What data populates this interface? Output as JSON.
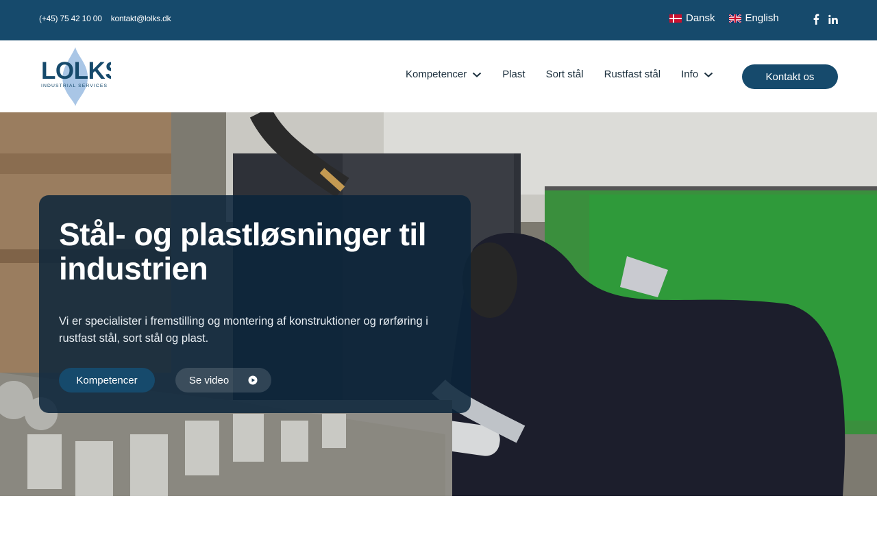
{
  "topbar": {
    "phone": "(+45) 75 42 10 00",
    "email": "kontakt@lolks.dk",
    "languages": [
      {
        "label": "Dansk",
        "flag": "flag-dk-icon"
      },
      {
        "label": "English",
        "flag": "flag-gb-icon"
      }
    ],
    "social": [
      "facebook-icon",
      "linkedin-icon"
    ]
  },
  "header": {
    "logo": {
      "text": "LOLKS",
      "tagline": "INDUSTRIAL SERVICES"
    },
    "nav": [
      {
        "label": "Kompetencer",
        "dropdown": true
      },
      {
        "label": "Plast",
        "dropdown": false
      },
      {
        "label": "Sort stål",
        "dropdown": false
      },
      {
        "label": "Rustfast stål",
        "dropdown": false
      },
      {
        "label": "Info",
        "dropdown": true
      }
    ],
    "cta_label": "Kontakt os"
  },
  "hero": {
    "title": "Stål- og plastløsninger til industrien",
    "description": "Vi er specialister i fremstilling og montering af konstruktioner og rørføring i rustfast stål, sort stål og plast.",
    "primary_button": "Kompetencer",
    "video_button": "Se video"
  },
  "colors": {
    "brand": "#164a6c",
    "card_bg": "#0a243a",
    "text_dark": "#1b2f3d"
  }
}
